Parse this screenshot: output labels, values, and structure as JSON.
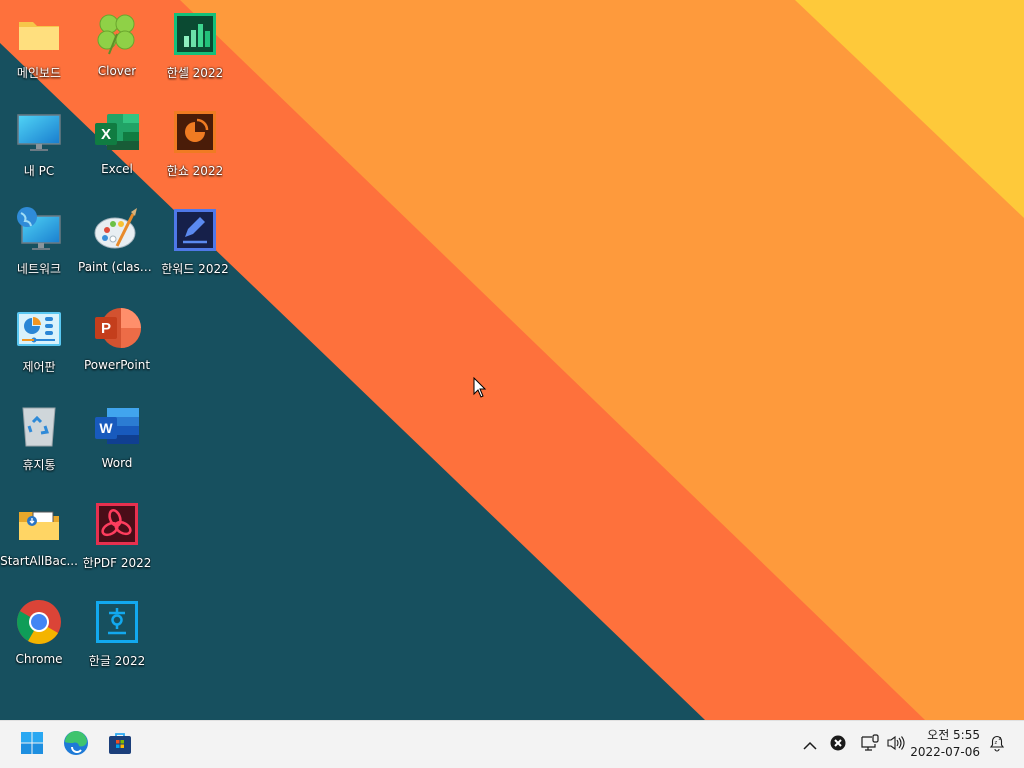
{
  "wallpaper": {
    "colors": {
      "teal": "#17505f",
      "orange_red": "#fe713c",
      "orange": "#fe9a3c",
      "yellow": "#fec93a"
    }
  },
  "desktop_icons": [
    {
      "label": "메인보드",
      "icon": "folder-icon"
    },
    {
      "label": "내 PC",
      "icon": "monitor-icon"
    },
    {
      "label": "네트워크",
      "icon": "network-icon"
    },
    {
      "label": "제어판",
      "icon": "control-panel-icon"
    },
    {
      "label": "휴지통",
      "icon": "recycle-bin-icon"
    },
    {
      "label": "StartAllBac...",
      "icon": "startallback-folder-icon"
    },
    {
      "label": "Chrome",
      "icon": "chrome-icon"
    },
    {
      "label": "Clover",
      "icon": "clover-icon"
    },
    {
      "label": "Excel",
      "icon": "excel-icon"
    },
    {
      "label": "Paint (classic)",
      "icon": "paint-icon"
    },
    {
      "label": "PowerPoint",
      "icon": "powerpoint-icon"
    },
    {
      "label": "Word",
      "icon": "word-icon"
    },
    {
      "label": "한PDF 2022",
      "icon": "hanpdf-icon"
    },
    {
      "label": "한글 2022",
      "icon": "hangul-icon"
    },
    {
      "label": "한셀 2022",
      "icon": "hancell-icon"
    },
    {
      "label": "한쇼 2022",
      "icon": "hanshow-icon"
    },
    {
      "label": "한워드 2022",
      "icon": "hanword-icon"
    }
  ],
  "taskbar": {
    "pinned": [
      {
        "name": "Start",
        "icon": "windows-start-icon"
      },
      {
        "name": "Microsoft Edge",
        "icon": "edge-icon"
      },
      {
        "name": "Microsoft Store",
        "icon": "store-icon"
      }
    ],
    "tray": {
      "overflow_icon": "chevron-up-icon",
      "app_icon": "close-circle-icon",
      "network_icon": "network-wired-icon",
      "volume_icon": "speaker-icon",
      "notification_icon": "bell-snooze-icon"
    },
    "clock": {
      "time": "오전 5:55",
      "date": "2022-07-06"
    }
  }
}
